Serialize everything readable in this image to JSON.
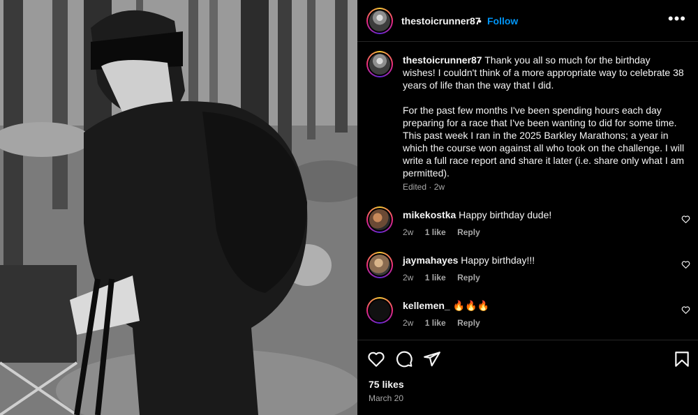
{
  "post": {
    "author": "thestoicrunner87",
    "follow_label": "Follow",
    "dot": "•",
    "more_label": "•••",
    "caption_username": "thestoicrunner87",
    "caption": " Thank you all so much for the birthday wishes! I couldn't think of a more appropriate way to celebrate 38 years of life than the way that I did.\n\nFor the past few months I've been spending hours each day preparing for a race that I've been wanting to did for some time. This past week I ran in the 2025 Barkley Marathons; a year in which the course won against all who took on the challenge. I will write a full race report and share it later (i.e. share only what I am permitted).",
    "caption_meta": "Edited · 2w",
    "likes": "75 likes",
    "date": "March 20"
  },
  "comments": [
    {
      "username": "mikekostka",
      "text": " Happy birthday dude!",
      "age": "2w",
      "likes": "1 like",
      "reply": "Reply"
    },
    {
      "username": "jaymahayes",
      "text": " Happy birthday!!!",
      "age": "2w",
      "likes": "1 like",
      "reply": "Reply"
    },
    {
      "username": "kellemen_",
      "text": " 🔥🔥🔥",
      "age": "2w",
      "likes": "1 like",
      "reply": "Reply"
    }
  ],
  "icons": {
    "like": "heart-icon",
    "comment": "comment-icon",
    "share": "share-icon",
    "save": "bookmark-icon",
    "more": "more-options-icon"
  },
  "colors": {
    "background": "#000000",
    "follow": "#0095f6",
    "muted": "#a8a8a8",
    "divider": "#262626"
  }
}
